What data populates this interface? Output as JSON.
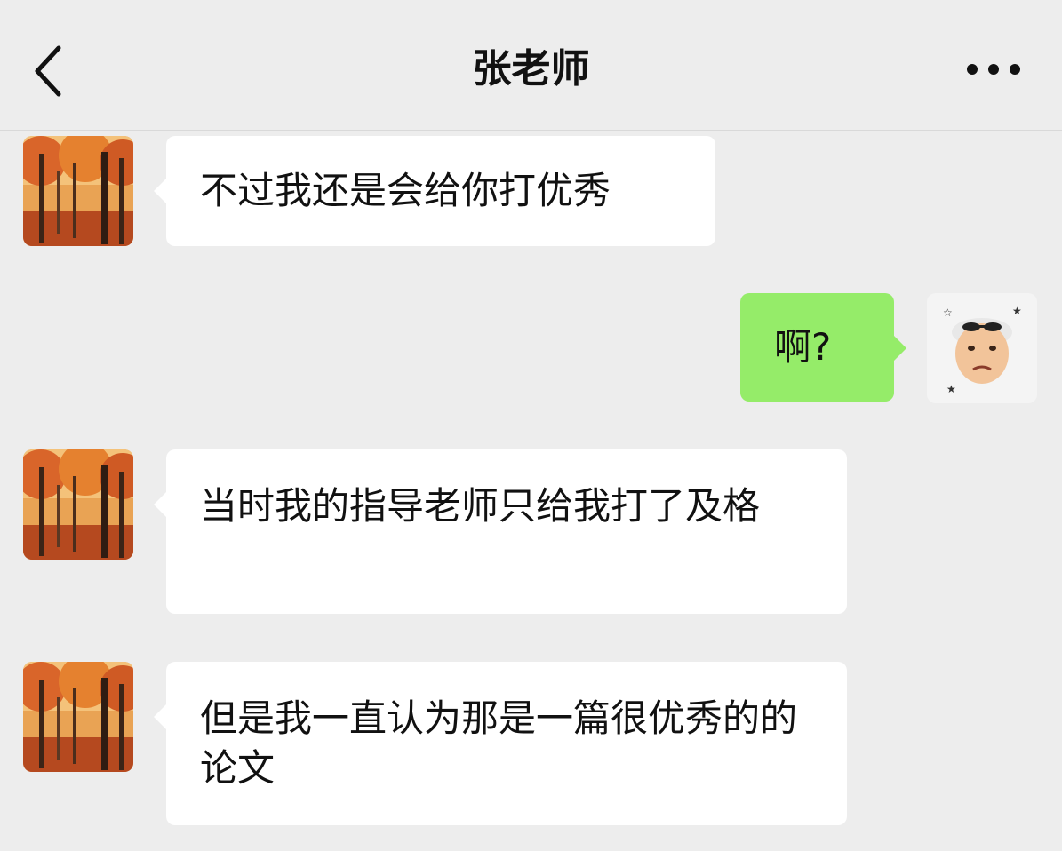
{
  "header": {
    "title": "张老师",
    "back_icon": "chevron-left-icon",
    "more_icon": "more-dots-icon"
  },
  "colors": {
    "background": "#ededed",
    "incoming_bubble": "#ffffff",
    "outgoing_bubble": "#95ec69"
  },
  "messages": [
    {
      "sender": "teacher",
      "direction": "incoming",
      "text": "不过我还是会给你打优秀"
    },
    {
      "sender": "me",
      "direction": "outgoing",
      "text": "啊?"
    },
    {
      "sender": "teacher",
      "direction": "incoming",
      "text": "当时我的指导老师只给我打了及格"
    },
    {
      "sender": "teacher",
      "direction": "incoming",
      "text": "但是我一直认为那是一篇很优秀的的论文"
    }
  ]
}
